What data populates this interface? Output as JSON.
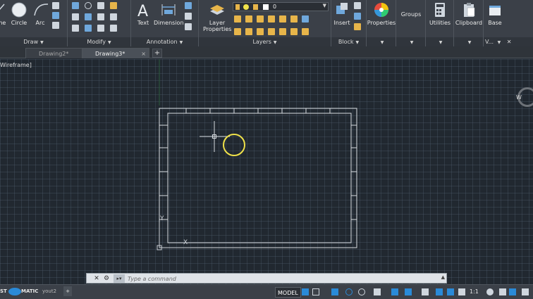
{
  "ribbon": {
    "draw_panel": {
      "title": "Draw",
      "tools": [
        "me",
        "Circle",
        "Arc"
      ]
    },
    "modify_panel": {
      "title": "Modify"
    },
    "annotation_panel": {
      "title": "Annotation",
      "tools": [
        "Text",
        "Dimension"
      ]
    },
    "layers_panel": {
      "title": "Layers",
      "layer_properties_label_line1": "Layer",
      "layer_properties_label_line2": "Properties",
      "current_layer": "0"
    },
    "block_panel": {
      "title": "Block",
      "insert_label": "Insert"
    },
    "properties_label": "Properties",
    "groups_label": "Groups",
    "utilities_label": "Utilities",
    "clipboard_label": "Clipboard",
    "base_label": "Base",
    "view_panel_title": "V..."
  },
  "tabs": [
    {
      "label": "Drawing2*",
      "close": "×"
    },
    {
      "label": "Drawing3*",
      "close": "×"
    }
  ],
  "new_tab": "+",
  "viewport": {
    "visual_style_label": "Wireframe]",
    "viewcube_letter": "W",
    "ucs_y": "Y",
    "ucs_x": "X"
  },
  "command_line": {
    "close": "✕",
    "settings": "⚙",
    "placeholder": "Type a command"
  },
  "statusbar": {
    "layout_tab_text": "ST",
    "layout_tab_text2": "MATIC",
    "layout2": "yout2",
    "add_layout": "+",
    "model": "MODEL",
    "scale": "1:1"
  },
  "colors": {
    "ribbon_bg": "#3b4048",
    "canvas_bg": "#212830",
    "drawing_lines": "#d7dbe0",
    "cursor_circle": "#f0e24a",
    "accent_blue": "#2a8ad8"
  }
}
